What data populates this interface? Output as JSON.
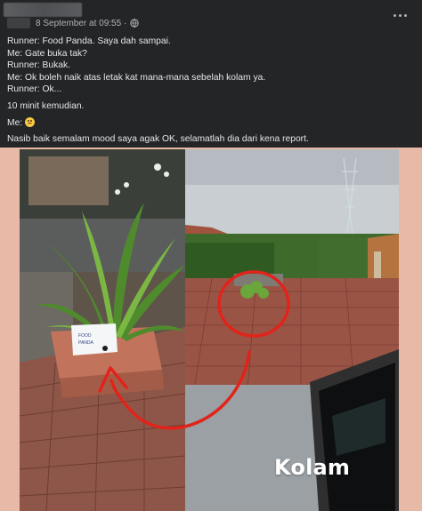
{
  "post": {
    "timestamp": "8 September at 09:55 ·",
    "privacy_icon": "globe-icon",
    "more_icon": "more-options-icon",
    "lines": [
      "Runner: Food Panda. Saya dah sampai.",
      "Me: Gate buka tak?",
      "Runner: Bukak.",
      "Me: Ok boleh naik atas letak kat mana-mana sebelah kolam ya.",
      "Runner: Ok..."
    ],
    "followup": "10 minit kemudian.",
    "me_reaction_label": "Me:",
    "reaction_emoji": "sad-face-emoji",
    "closing": "Nasib baik semalam mood saya agak OK, selamatlah dia dari kena report."
  },
  "photo": {
    "caption": "Kolam",
    "background_color": "#e8b9a6",
    "annotation_color": "#e2231a"
  }
}
